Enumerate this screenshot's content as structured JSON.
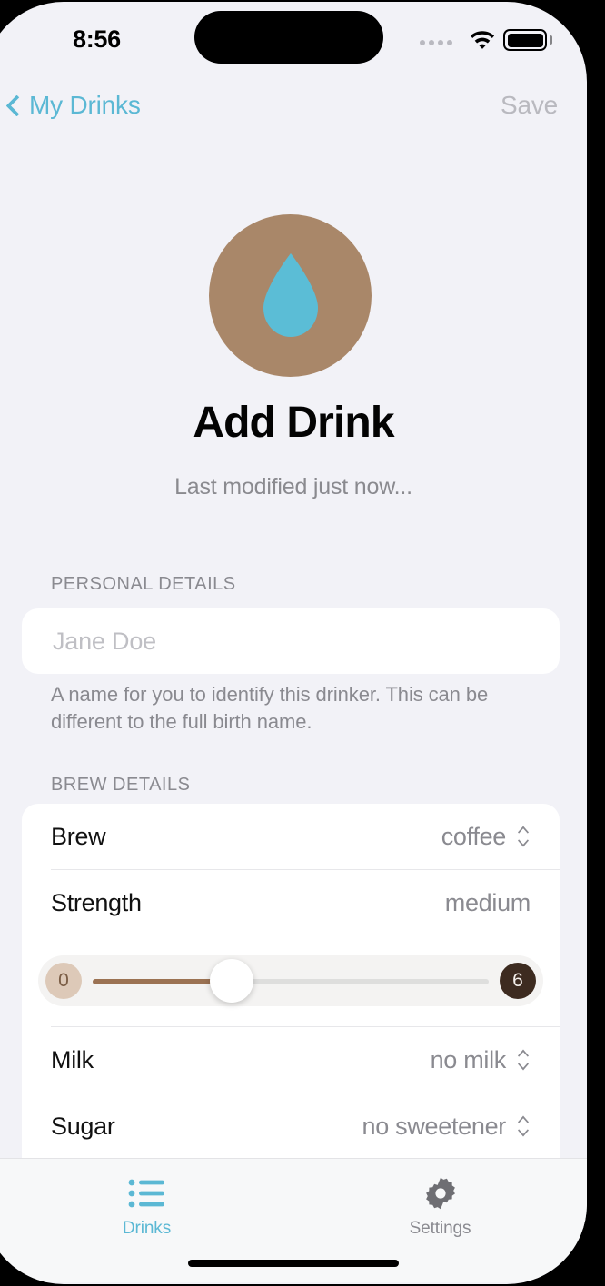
{
  "theme": {
    "accent": "#5bb8d4",
    "avatar_bg": "#a98769",
    "droplet": "#5bbdd6",
    "page_bg": "#f2f2f7",
    "card_bg": "#ffffff",
    "slider_fill": "#9b7253",
    "badge_min_bg": "#ddc9b8",
    "badge_max_bg": "#3d2b20",
    "muted_text": "#8a8a90"
  },
  "status_bar": {
    "time": "8:56",
    "cellular_icon": "cellular-dots-icon",
    "wifi_icon": "wifi-icon",
    "battery_icon": "battery-full-icon"
  },
  "nav_bar": {
    "back_icon": "chevron-left-icon",
    "back_label": "My Drinks",
    "save_label": "Save"
  },
  "header": {
    "avatar_icon": "water-droplet-icon",
    "title": "Add Drink",
    "subtitle": "Last modified just now..."
  },
  "sections": [
    {
      "label": "PERSONAL DETAILS",
      "field": {
        "value": "",
        "placeholder": "Jane Doe"
      },
      "hint": "A name for you to identify this drinker. This can be different to the full birth name."
    },
    {
      "label": "BREW DETAILS",
      "rows": [
        {
          "label": "Brew",
          "value": "coffee",
          "accessory": "up-down-chevron-icon"
        },
        {
          "label": "Strength",
          "value": "medium",
          "accessory": "none"
        },
        {
          "label": "Milk",
          "value": "no milk",
          "accessory": "up-down-chevron-icon"
        },
        {
          "label": "Sugar",
          "value": "no sweetener",
          "accessory": "up-down-chevron-icon"
        }
      ],
      "slider": {
        "min_label": "0",
        "max_label": "6",
        "value": 2,
        "min": 0,
        "max": 6,
        "fill_percent": 35
      }
    }
  ],
  "tab_bar": {
    "items": [
      {
        "label": "Drinks",
        "icon": "bulleted-list-icon",
        "active": true
      },
      {
        "label": "Settings",
        "icon": "gear-icon",
        "active": false
      }
    ]
  }
}
